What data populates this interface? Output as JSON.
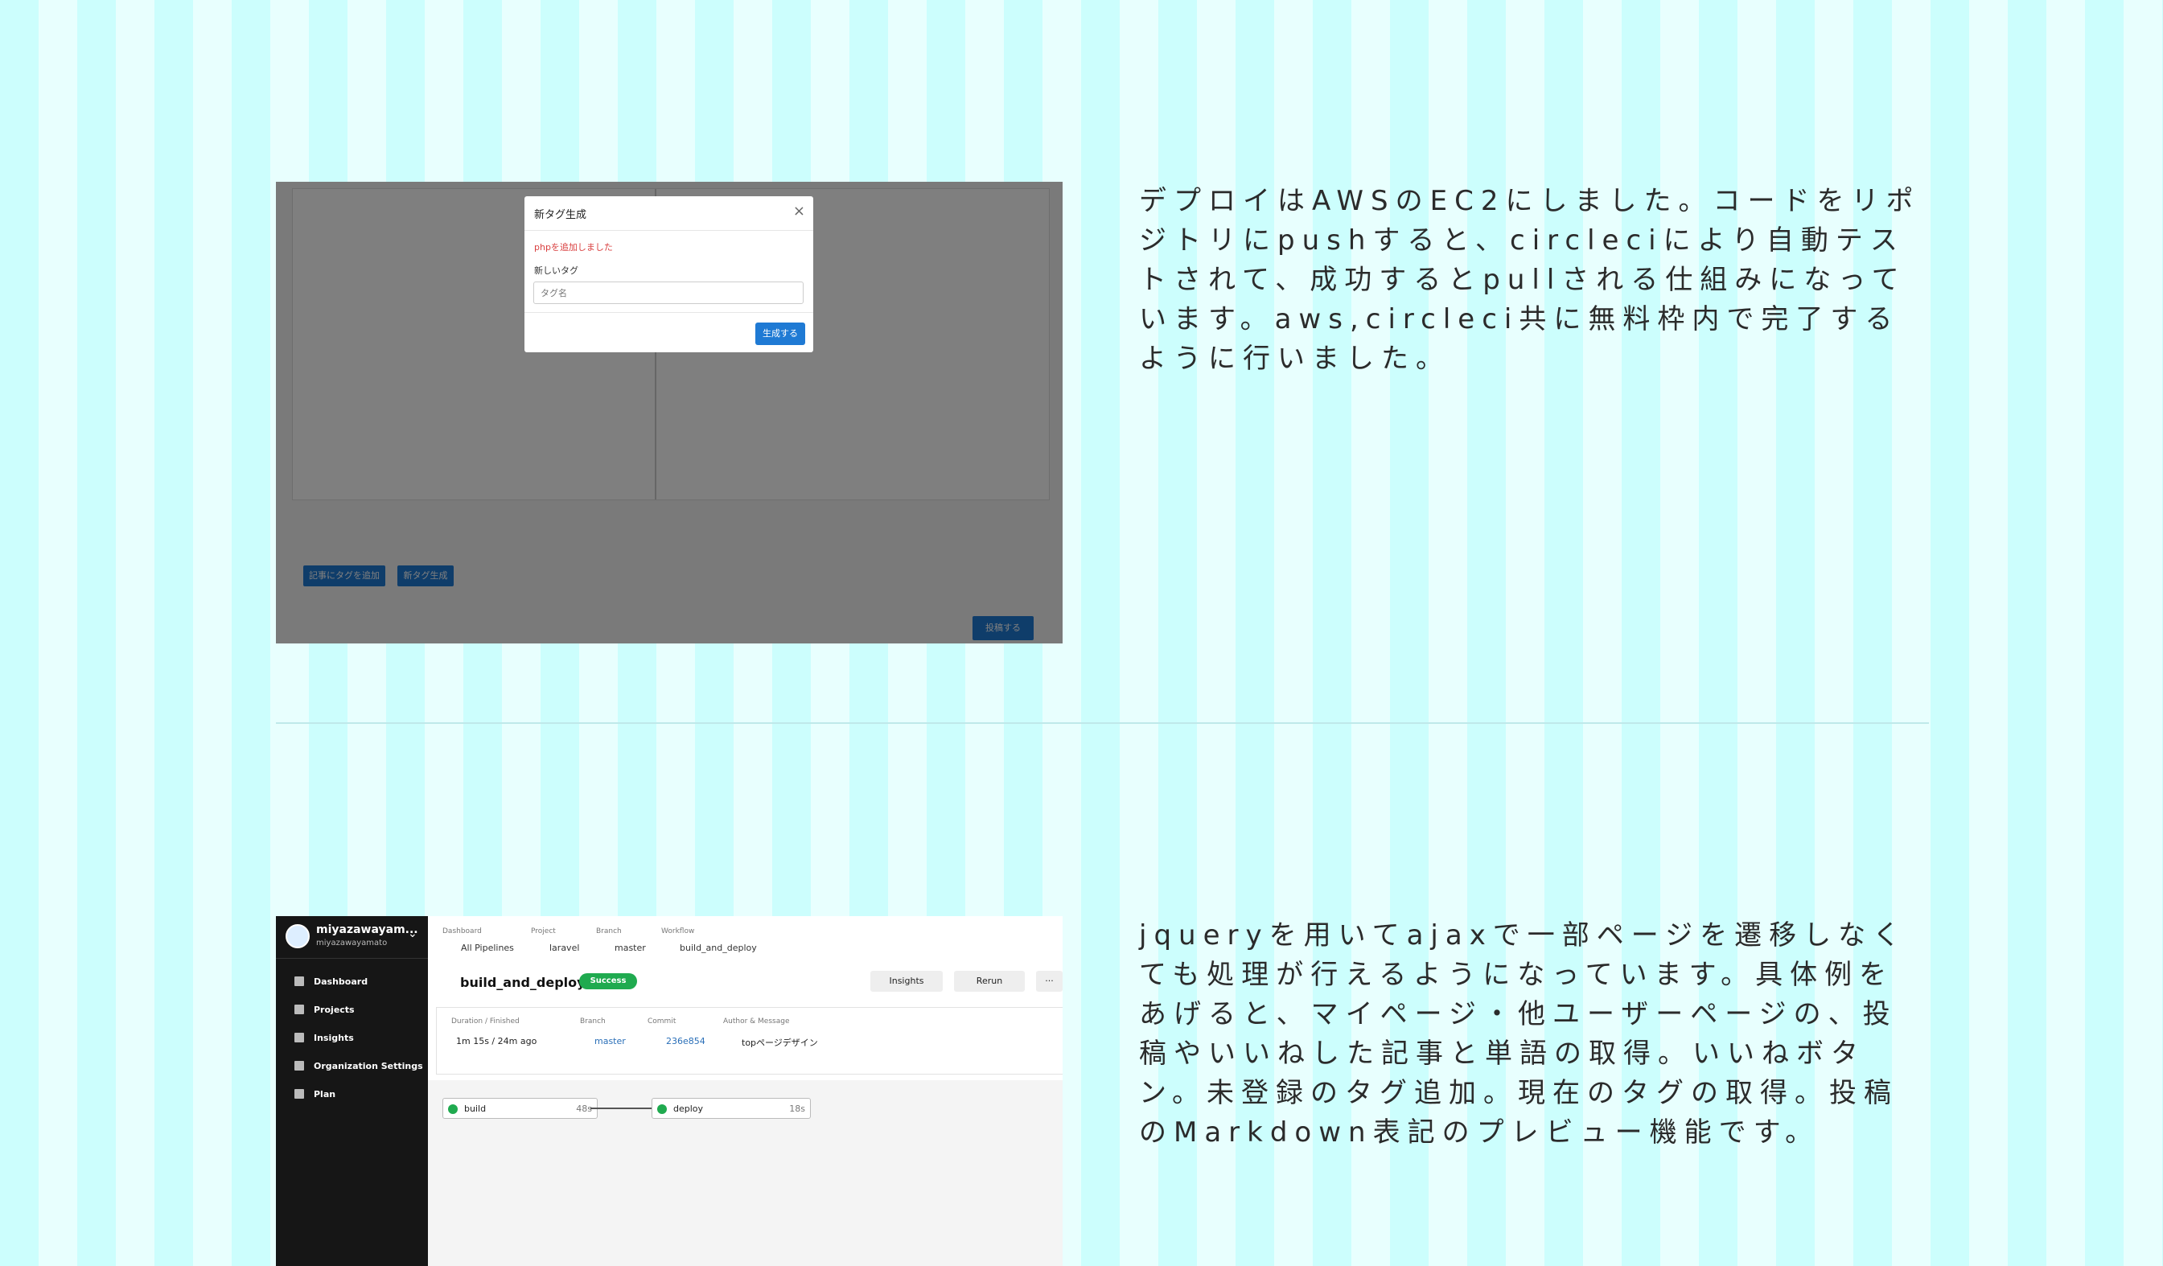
{
  "sections": [
    {
      "description": "デプロイはAWSのEC2にしました。コードをリポジトリにpushすると、circleciにより自動テストされて、成功するとpullされる仕組みになっています。aws,circleci共に無料枠内で完了するように行いました。",
      "screenshot": {
        "modal": {
          "title": "新タグ生成",
          "close": "×",
          "message": "phpを追加しました",
          "field_label": "新しいタグ",
          "placeholder": "タグ名",
          "submit": "生成する"
        },
        "buttons": {
          "add_tag": "記事にタグを追加",
          "new_tag": "新タグ生成",
          "post": "投稿する"
        }
      }
    },
    {
      "description": "jqueryを用いてajaxで一部ページを遷移しなくても処理が行えるようになっています。具体例をあげると、マイページ・他ユーザーページの、投稿やいいねした記事と単語の取得。いいねボタン。未登録のタグ追加。現在のタグの取得。投稿のMarkdown表記のプレビュー機能です。",
      "screenshot": {
        "sidebar": {
          "org_name": "miyazawayam...",
          "org_sub": "miyazawayamato",
          "items": [
            "Dashboard",
            "Projects",
            "Insights",
            "Organization Settings",
            "Plan"
          ]
        },
        "breadcrumb_labels": {
          "dashboard": "Dashboard",
          "project": "Project",
          "branch": "Branch",
          "workflow": "Workflow"
        },
        "breadcrumb_values": {
          "dashboard": "All Pipelines",
          "project": "laravel",
          "branch": "master",
          "workflow": "build_and_deploy"
        },
        "title": "build_and_deploy",
        "status": "Success",
        "actions": {
          "insights": "Insights",
          "rerun": "Rerun",
          "more": "···"
        },
        "info_labels": {
          "duration": "Duration / Finished",
          "branch": "Branch",
          "commit": "Commit",
          "author": "Author & Message"
        },
        "info_values": {
          "duration": "1m 15s / 24m ago",
          "branch": "master",
          "commit": "236e854",
          "message": "topページデザイン"
        },
        "jobs": [
          {
            "name": "build",
            "time": "48s"
          },
          {
            "name": "deploy",
            "time": "18s"
          }
        ]
      }
    }
  ],
  "colors": {
    "background_stripe_a": "#ccfefd",
    "background_stripe_b": "#e8fffe",
    "success": "#1faa4f",
    "primary_button": "#1f7ad4"
  }
}
